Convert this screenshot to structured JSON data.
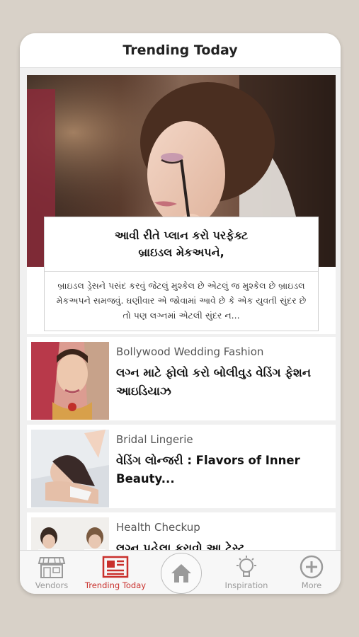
{
  "header": {
    "title": "Trending Today"
  },
  "hero": {
    "title": "આવી રીતે પ્લાન કરો પરફેક્ટ\nબ્રાઇડલ મેકઅપને,",
    "description": "બ્રાઇડલ ડ્રેસને પસંદ કરવું જેટલું મુશ્કેલ છે એટલું જ મુશ્કેલ છે બ્રાઇડલ મેકઅપને સમજવું. ઘણીવાર એ જોવામાં આવે છે કે એક યુવતી સુંદર છે તો પણ લગ્નમાં એટલી સુંદર ન..."
  },
  "articles": [
    {
      "category": "Bollywood Wedding Fashion",
      "title": "લગ્ન માટે ફોલો કરો બોલીવુડ વેડિંગ ફેશન આઇડિયાઝ"
    },
    {
      "category": "Bridal Lingerie",
      "title": "વેડિંગ લોન્જરી : Flavors of Inner Beauty..."
    },
    {
      "category": "Health Checkup",
      "title": "લગ્ન પહેલા કરાવો આ ટેસ્ટ"
    }
  ],
  "tabs": [
    {
      "label": "Vendors",
      "icon": "storefront-icon"
    },
    {
      "label": "Trending Today",
      "icon": "newspaper-icon"
    },
    {
      "label": "",
      "icon": "home-icon"
    },
    {
      "label": "Inspiration",
      "icon": "lightbulb-icon"
    },
    {
      "label": "More",
      "icon": "plus-circle-icon"
    }
  ],
  "colors": {
    "accent": "#c9302c",
    "inactive": "#9a9a9a",
    "background": "#d8d1c8"
  }
}
